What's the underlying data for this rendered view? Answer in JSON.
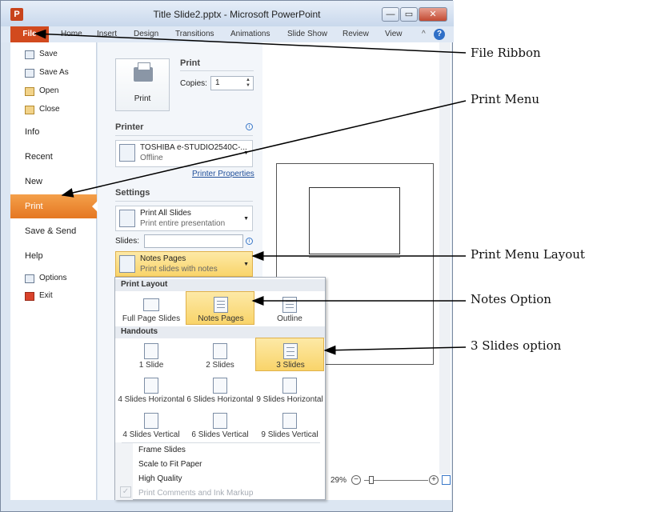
{
  "window": {
    "app_icon": "P",
    "title": "Title Slide2.pptx - Microsoft PowerPoint",
    "controls": {
      "minimize": "—",
      "maximize": "▭",
      "close": "✕"
    }
  },
  "ribbon": {
    "file_tab": "File",
    "tabs": [
      "Home",
      "Insert",
      "Design",
      "Transitions",
      "Animations",
      "Slide Show",
      "Review",
      "View"
    ],
    "help": "?",
    "minimize_caret": "^"
  },
  "backstage_nav": {
    "commands": [
      {
        "label": "Save",
        "icon": "save-icon"
      },
      {
        "label": "Save As",
        "icon": "save-as-icon"
      },
      {
        "label": "Open",
        "icon": "open-folder-icon"
      },
      {
        "label": "Close",
        "icon": "close-folder-icon"
      }
    ],
    "items": [
      "Info",
      "Recent",
      "New",
      "Print",
      "Save & Send",
      "Help"
    ],
    "active": "Print",
    "bottom_commands": [
      {
        "label": "Options",
        "icon": "options-icon"
      },
      {
        "label": "Exit",
        "icon": "exit-icon"
      }
    ]
  },
  "print_panel": {
    "print_button": "Print",
    "print_heading": "Print",
    "copies_label": "Copies:",
    "copies_value": "1",
    "printer_heading": "Printer",
    "printer_name": "TOSHIBA e-STUDIO2540C-...",
    "printer_status": "Offline",
    "printer_properties": "Printer Properties",
    "settings_heading": "Settings",
    "print_range": {
      "title": "Print All Slides",
      "subtitle": "Print entire presentation"
    },
    "slides_label": "Slides:",
    "slides_value": "",
    "layout": {
      "title": "Notes Pages",
      "subtitle": "Print slides with notes"
    }
  },
  "layout_gallery": {
    "print_layout_heading": "Print Layout",
    "print_layouts": [
      "Full Page Slides",
      "Notes Pages",
      "Outline"
    ],
    "handouts_heading": "Handouts",
    "handouts": [
      "1 Slide",
      "2 Slides",
      "3 Slides",
      "4 Slides Horizontal",
      "6 Slides Horizontal",
      "9 Slides Horizontal",
      "4 Slides Vertical",
      "6 Slides Vertical",
      "9 Slides Vertical"
    ],
    "selected_layout": "Notes Pages",
    "highlighted_handout": "3 Slides",
    "options": [
      {
        "label": "Frame Slides",
        "enabled": true
      },
      {
        "label": "Scale to Fit Paper",
        "enabled": true
      },
      {
        "label": "High Quality",
        "enabled": true
      },
      {
        "label": "Print Comments and Ink Markup",
        "enabled": false
      }
    ]
  },
  "preview": {
    "zoom": "29%",
    "zoom_level_fraction": 0.29
  },
  "annotations": [
    "File Ribbon",
    "Print Menu",
    "Print Menu Layout",
    "Notes Option",
    "3 Slides option"
  ],
  "colors": {
    "file_tab": "#d24a1e",
    "print_selected": "#e57722",
    "highlight": "#f9d46a"
  }
}
